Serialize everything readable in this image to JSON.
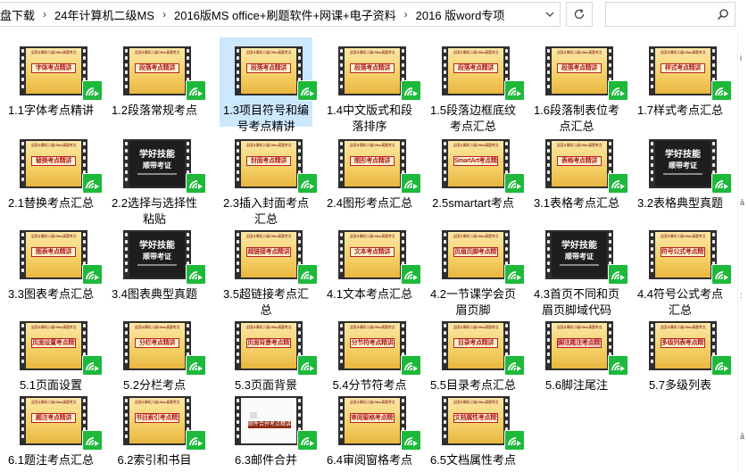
{
  "address_bar": {
    "crumbs": [
      "盘下载",
      "24年计算机二级MS",
      "2016版MS office+刷题软件+网课+电子资料",
      "2016 版word专项"
    ]
  },
  "search": {
    "placeholder": ""
  },
  "right_edge": {
    "marks": [
      "i",
      "ā",
      ":",
      "ā"
    ]
  },
  "colors": {
    "selected_bg": "#cce8ff",
    "badge_green": "#1db93b",
    "slide_red": "#b11d23",
    "slide_gold": "#f3cf66"
  },
  "slide_top_text": "全国计算机二级Office真题考点",
  "dark_text": {
    "line1": "学好技能",
    "line2": "顺带考证",
    "line3": ""
  },
  "files": [
    {
      "label": "1.1字体考点精讲",
      "thumb": "slide",
      "banner": "字体考点精讲"
    },
    {
      "label": "1.2段落常规考点",
      "thumb": "slide",
      "banner": "段落考点精讲"
    },
    {
      "label": "1.3项目符号和编号考点精讲",
      "thumb": "slide",
      "banner": "段落考点精讲",
      "selected": true
    },
    {
      "label": "1.4中文版式和段落排序",
      "thumb": "slide",
      "banner": "段落考点精讲"
    },
    {
      "label": "1.5段落边框底纹考点汇总",
      "thumb": "slide",
      "banner": "段落考点精讲"
    },
    {
      "label": "1.6段落制表位考点汇总",
      "thumb": "slide",
      "banner": "段落考点精讲"
    },
    {
      "label": "1.7样式考点汇总",
      "thumb": "slide",
      "banner": "样式考点精讲"
    },
    {
      "label": "2.1替换考点汇总",
      "thumb": "slide",
      "banner": "替换考点精讲"
    },
    {
      "label": "2.2选择与选择性粘贴",
      "thumb": "dark"
    },
    {
      "label": "2.3插入封面考点汇总",
      "thumb": "slide",
      "banner": "封面考点精讲"
    },
    {
      "label": "2.4图形考点汇总",
      "thumb": "slide",
      "banner": "图形考点精讲"
    },
    {
      "label": "2.5smartart考点",
      "thumb": "slide",
      "banner": "SmartArt考点精讲"
    },
    {
      "label": "3.1表格考点汇总",
      "thumb": "slide",
      "banner": "表格考点精讲"
    },
    {
      "label": "3.2表格典型真题",
      "thumb": "dark"
    },
    {
      "label": "3.3图表考点汇总",
      "thumb": "slide",
      "banner": "图表考点精讲"
    },
    {
      "label": "3.4图表典型真题",
      "thumb": "dark"
    },
    {
      "label": "3.5超链接考点汇总",
      "thumb": "slide",
      "banner": "超链接考点精讲"
    },
    {
      "label": "4.1文本考点汇总",
      "thumb": "slide",
      "banner": "文本考点精讲"
    },
    {
      "label": "4.2一节课学会页眉页脚",
      "thumb": "slide",
      "banner": "页眉页脚考点精讲"
    },
    {
      "label": "4.3首页不同和页眉页脚域代码",
      "thumb": "dark"
    },
    {
      "label": "4.4符号公式考点汇总",
      "thumb": "slide",
      "banner": "符号公式考点精讲"
    },
    {
      "label": "5.1页面设置",
      "thumb": "slide",
      "banner": "页面设置考点精讲"
    },
    {
      "label": "5.2分栏考点",
      "thumb": "slide",
      "banner": "分栏考点精讲"
    },
    {
      "label": "5.3页面背景",
      "thumb": "slide",
      "banner": "页面背景考点精讲"
    },
    {
      "label": "5.4分节符考点",
      "thumb": "slide",
      "banner": "分节符考点精讲"
    },
    {
      "label": "5.5目录考点汇总",
      "thumb": "slide",
      "banner": "目录考点精讲"
    },
    {
      "label": "5.6脚注尾注",
      "thumb": "slide",
      "banner": "脚注尾注考点精讲",
      "pink": true
    },
    {
      "label": "5.7多级列表",
      "thumb": "slide",
      "banner": "多级列表考点精讲"
    },
    {
      "label": "6.1题注考点汇总",
      "thumb": "slide",
      "banner": "题注考点精讲"
    },
    {
      "label": "6.2索引和书目",
      "thumb": "slide",
      "banner": "书目索引考点精讲"
    },
    {
      "label": "6.3邮件合并",
      "thumb": "white",
      "banner": "邮件合并考点精讲"
    },
    {
      "label": "6.4审阅窗格考点",
      "thumb": "slide",
      "banner": "审阅窗格考点精讲"
    },
    {
      "label": "6.5文档属性考点",
      "thumb": "slide",
      "banner": "文档属性考点精讲"
    }
  ]
}
